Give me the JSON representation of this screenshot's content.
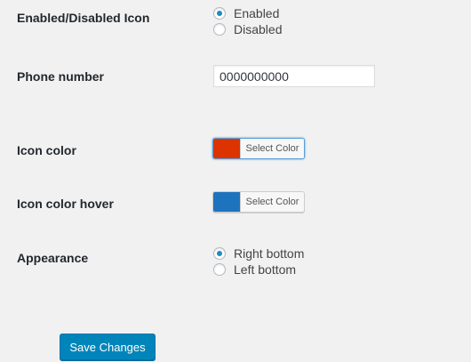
{
  "form": {
    "enabled_icon": {
      "label": "Enabled/Disabled Icon",
      "options": [
        {
          "label": "Enabled",
          "checked": true
        },
        {
          "label": "Disabled",
          "checked": false
        }
      ]
    },
    "phone": {
      "label": "Phone number",
      "value": "0000000000"
    },
    "icon_color": {
      "label": "Icon color",
      "button_label": "Select Color",
      "color": "#dd3300"
    },
    "icon_color_hover": {
      "label": "Icon color hover",
      "button_label": "Select Color",
      "color": "#1e73be"
    },
    "appearance": {
      "label": "Appearance",
      "options": [
        {
          "label": "Right bottom",
          "checked": true
        },
        {
          "label": "Left bottom",
          "checked": false
        }
      ]
    },
    "submit_label": "Save Changes"
  },
  "colors": {
    "accent": "#0085ba",
    "radio_dot": "#1e8cbe"
  }
}
